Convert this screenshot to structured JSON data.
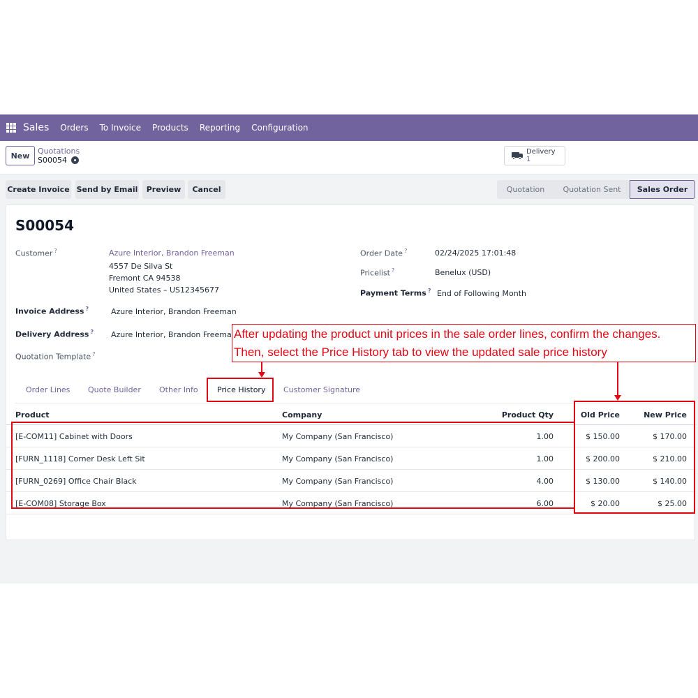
{
  "navbar": {
    "brand": "Sales",
    "items": [
      "Orders",
      "To Invoice",
      "Products",
      "Reporting",
      "Configuration"
    ]
  },
  "control": {
    "new_label": "New",
    "breadcrumb_parent": "Quotations",
    "breadcrumb_current": "S00054",
    "smart_button": {
      "label": "Delivery",
      "count": "1"
    }
  },
  "actions": {
    "create_invoice": "Create Invoice",
    "send_by_email": "Send by Email",
    "preview": "Preview",
    "cancel": "Cancel"
  },
  "status": {
    "stages": [
      "Quotation",
      "Quotation Sent",
      "Sales Order"
    ],
    "active": "Sales Order"
  },
  "form": {
    "title": "S00054",
    "customer_label": "Customer",
    "customer_name": "Azure Interior, Brandon Freeman",
    "customer_street": "4557 De Silva St",
    "customer_city": "Fremont CA 94538",
    "customer_country": "United States – US12345677",
    "invoice_address_label": "Invoice Address",
    "invoice_address": "Azure Interior, Brandon Freeman",
    "delivery_address_label": "Delivery Address",
    "delivery_address": "Azure Interior, Brandon Freeman",
    "quotation_template_label": "Quotation Template",
    "order_date_label": "Order Date",
    "order_date": "02/24/2025 17:01:48",
    "pricelist_label": "Pricelist",
    "pricelist": "Benelux (USD)",
    "payment_terms_label": "Payment Terms",
    "payment_terms": "End of Following Month",
    "help_mark": "?"
  },
  "tabs": [
    "Order Lines",
    "Quote Builder",
    "Other Info",
    "Price History",
    "Customer Signature"
  ],
  "active_tab": "Price History",
  "table": {
    "headers": [
      "Product",
      "Company",
      "Product Qty",
      "Old Price",
      "New Price"
    ],
    "rows": [
      {
        "product": "[E-COM11] Cabinet with Doors",
        "company": "My Company (San Francisco)",
        "qty": "1.00",
        "old": "$ 150.00",
        "new": "$ 170.00"
      },
      {
        "product": "[FURN_1118] Corner Desk Left Sit",
        "company": "My Company (San Francisco)",
        "qty": "1.00",
        "old": "$ 200.00",
        "new": "$ 210.00"
      },
      {
        "product": "[FURN_0269] Office Chair Black",
        "company": "My Company (San Francisco)",
        "qty": "4.00",
        "old": "$ 130.00",
        "new": "$ 140.00"
      },
      {
        "product": "[E-COM08] Storage Box",
        "company": "My Company (San Francisco)",
        "qty": "6.00",
        "old": "$ 20.00",
        "new": "$ 25.00"
      }
    ]
  },
  "annotation": {
    "line1": "After updating the product unit prices in the sale order lines, confirm the changes.",
    "line2": "Then, select the Price History tab to view the updated sale price history",
    "color": "#e30613"
  },
  "colors": {
    "brand": "#71639e",
    "annotation": "#e30613"
  }
}
